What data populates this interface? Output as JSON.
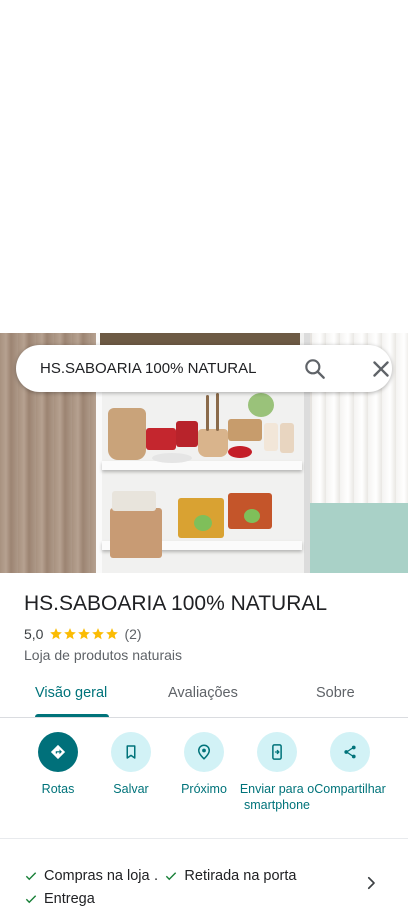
{
  "search": {
    "query": "HS.SABOARIA 100% NATURAL"
  },
  "place": {
    "name": "HS.SABOARIA 100% NATURAL",
    "rating": "5,0",
    "stars": 5,
    "review_count": "(2)",
    "category": "Loja de produtos naturais"
  },
  "tabs": [
    {
      "label": "Visão geral",
      "active": true
    },
    {
      "label": "Avaliações",
      "active": false
    },
    {
      "label": "Sobre",
      "active": false
    }
  ],
  "actions": [
    {
      "label": "Rotas",
      "icon": "directions-icon"
    },
    {
      "label": "Salvar",
      "icon": "bookmark-icon"
    },
    {
      "label": "Próximo",
      "icon": "nearby-icon"
    },
    {
      "label": "Enviar para o smartphone",
      "icon": "send-to-phone-icon"
    },
    {
      "label": "Compartilhar",
      "icon": "share-icon"
    }
  ],
  "services": [
    {
      "label": "Compras na loja"
    },
    {
      "label": "Retirada na porta"
    },
    {
      "label": "Entrega"
    }
  ],
  "services_separator": "·",
  "colors": {
    "accent": "#00737a",
    "star": "#fbbc04",
    "action_bg": "#d2f2f6",
    "check": "#188038"
  }
}
